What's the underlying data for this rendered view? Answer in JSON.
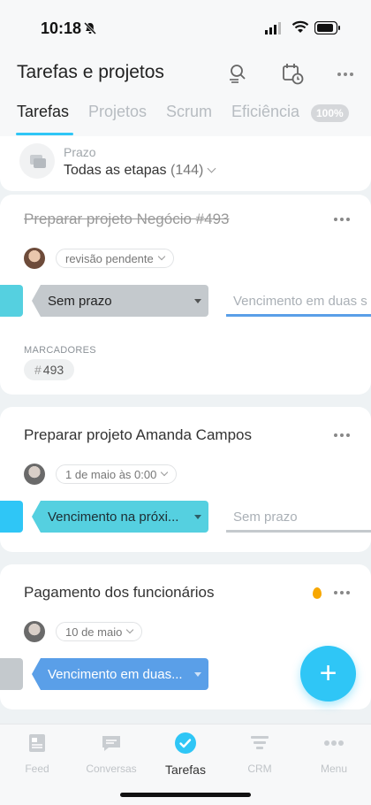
{
  "status_bar": {
    "time": "10:18"
  },
  "header": {
    "title": "Tarefas e projetos"
  },
  "tabs": [
    {
      "label": "Tarefas",
      "active": true
    },
    {
      "label": "Projetos"
    },
    {
      "label": "Scrum"
    },
    {
      "label": "Eficiência"
    }
  ],
  "efficiency_badge": "100%",
  "filter": {
    "label": "Prazo",
    "value": "Todas as etapas",
    "count": "(144)"
  },
  "tasks": [
    {
      "title": "Preparar projeto Negócio #493",
      "completed": true,
      "status_pill": "revisão pendente",
      "stage_current": "Sem prazo",
      "stage_next": "Vencimento em duas s",
      "tags_label": "MARCADORES",
      "tag": "493"
    },
    {
      "title": "Preparar projeto Amanda Campos",
      "deadline": "1 de maio às 0:00",
      "stage_current": "Vencimento na próxi...",
      "stage_next": "Sem prazo"
    },
    {
      "title": "Pagamento dos funcionários",
      "deadline": "10 de maio",
      "stage_current": "Vencimento em duas...",
      "hot": true
    }
  ],
  "fab_label": "+",
  "bottom_nav": [
    {
      "label": "Feed",
      "icon": "feed-icon"
    },
    {
      "label": "Conversas",
      "icon": "chat-icon"
    },
    {
      "label": "Tarefas",
      "icon": "tasks-check-icon",
      "active": true
    },
    {
      "label": "CRM",
      "icon": "crm-funnel-icon"
    },
    {
      "label": "Menu",
      "icon": "menu-dots-icon"
    }
  ],
  "colors": {
    "accent": "#2fc6f6",
    "stage_gray": "#c4c9cd",
    "stage_teal": "#55d0e0",
    "stage_blue": "#5a9fe8",
    "hot": "#f7a700"
  }
}
